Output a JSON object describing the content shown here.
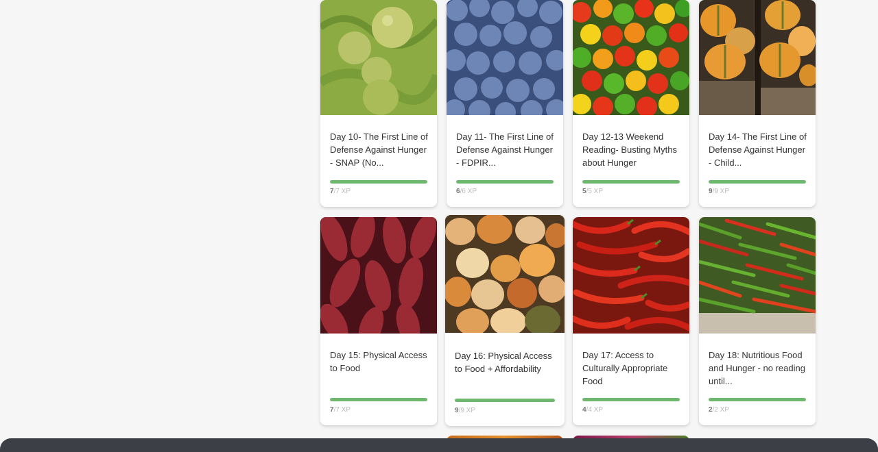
{
  "cards": [
    {
      "title": "Day 10- The First Line of Defense Against Hunger - SNAP (No...",
      "earned": "7",
      "total": "/7 XP",
      "progress": 1.0,
      "image": "green-apples"
    },
    {
      "title": "Day 11- The First Line of Defense Against Hunger - FDPIR...",
      "earned": "6",
      "total": "/6 XP",
      "progress": 1.0,
      "image": "blueberries"
    },
    {
      "title": "Day 12-13 Weekend Reading- Busting Myths about Hunger",
      "earned": "5",
      "total": "/5 XP",
      "progress": 1.0,
      "image": "habanero-peppers"
    },
    {
      "title": "Day 14- The First Line of Defense Against Hunger - Child...",
      "earned": "9",
      "total": "/9 XP",
      "progress": 1.0,
      "image": "squash-crates"
    },
    {
      "title": "Day 15: Physical Access to Food",
      "earned": "7",
      "total": "/7 XP",
      "progress": 1.0,
      "image": "red-corn"
    },
    {
      "title": "Day 16: Physical Access to Food + Affordability",
      "earned": "9",
      "total": "/9 XP",
      "progress": 1.0,
      "image": "pumpkins"
    },
    {
      "title": "Day 17: Access to Culturally Appropriate Food",
      "earned": "4",
      "total": "/4 XP",
      "progress": 1.0,
      "image": "red-chilies"
    },
    {
      "title": "Day 18: Nutritious Food and Hunger - no reading until...",
      "earned": "2",
      "total": "/2 XP",
      "progress": 1.0,
      "image": "green-red-chilies"
    }
  ],
  "colors": {
    "progress": "#6db86d",
    "footer": "#3d3f46"
  }
}
